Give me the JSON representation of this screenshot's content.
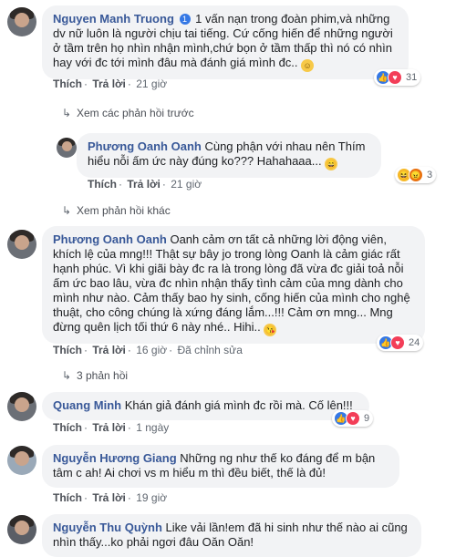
{
  "actions": {
    "like": "Thích",
    "reply": "Trả lời"
  },
  "comments": [
    {
      "name": "Nguyen Manh Truong",
      "text": "1 vấn nạn trong đoàn phim,và những dv nữ luôn là người chịu tai tiếng. Cứ cống hiến để những người ở tầm trên họ nhìn nhận mình,chứ bọn ở tầm thấp thì nó có nhìn hay với đc tới mình đâu mà đánh giá mình đc..",
      "time": "21 giờ",
      "reaction_count": "31",
      "verified": "1"
    },
    {
      "name": "Phương Oanh Oanh",
      "text": "Cùng phận với nhau nên Thím hiểu nỗi ấm ức này đúng ko??? Hahahaaa...",
      "time": "21 giờ",
      "reaction_count": "3"
    },
    {
      "name": "Phương Oanh Oanh",
      "text": "Oanh cảm ơn tất cả những lời động viên, khích lệ của mng!!! Thật sự bây jo trong lòng Oanh là cảm giác rất hạnh phúc. Vì khi giãi bày đc ra là trong lòng đã vừa đc giải toả nỗi ấm ức bao lâu, vừa đc nhìn nhận thấy tình cảm của mng dành cho mình như nào. Cảm thấy bao hy sinh, cống hiến của mình cho nghệ thuật, cho công chúng là xứng đáng lắm...!!! Cảm ơn mng... Mng đừng quên lịch tối thứ 6 này nhé.. Hihi..",
      "time": "16 giờ",
      "edited": "Đã chỉnh sửa",
      "reaction_count": "24"
    },
    {
      "name": "Quang Minh",
      "text": "Khán giả đánh giá mình đc rồi mà. Cố lên!!!",
      "time": "1 ngày",
      "reaction_count": "9"
    },
    {
      "name": "Nguyễn Hương Giang",
      "text": "Những ng như thế ko đáng để m bận tâm c ah! Ai chơi vs m hiểu m thì đều biết, thế là đủ!",
      "time": "19 giờ"
    },
    {
      "name": "Nguyễn Thu Quỳnh",
      "text": "Like vải lần!em đã hi sinh như thế nào ai cũng nhìn thấy...ko phải ngơi đâu Oăn Oăn!"
    }
  ],
  "view_previous": "Xem các phản hồi trước",
  "view_other": "Xem phản hồi khác",
  "replies_count": "3 phản hồi"
}
